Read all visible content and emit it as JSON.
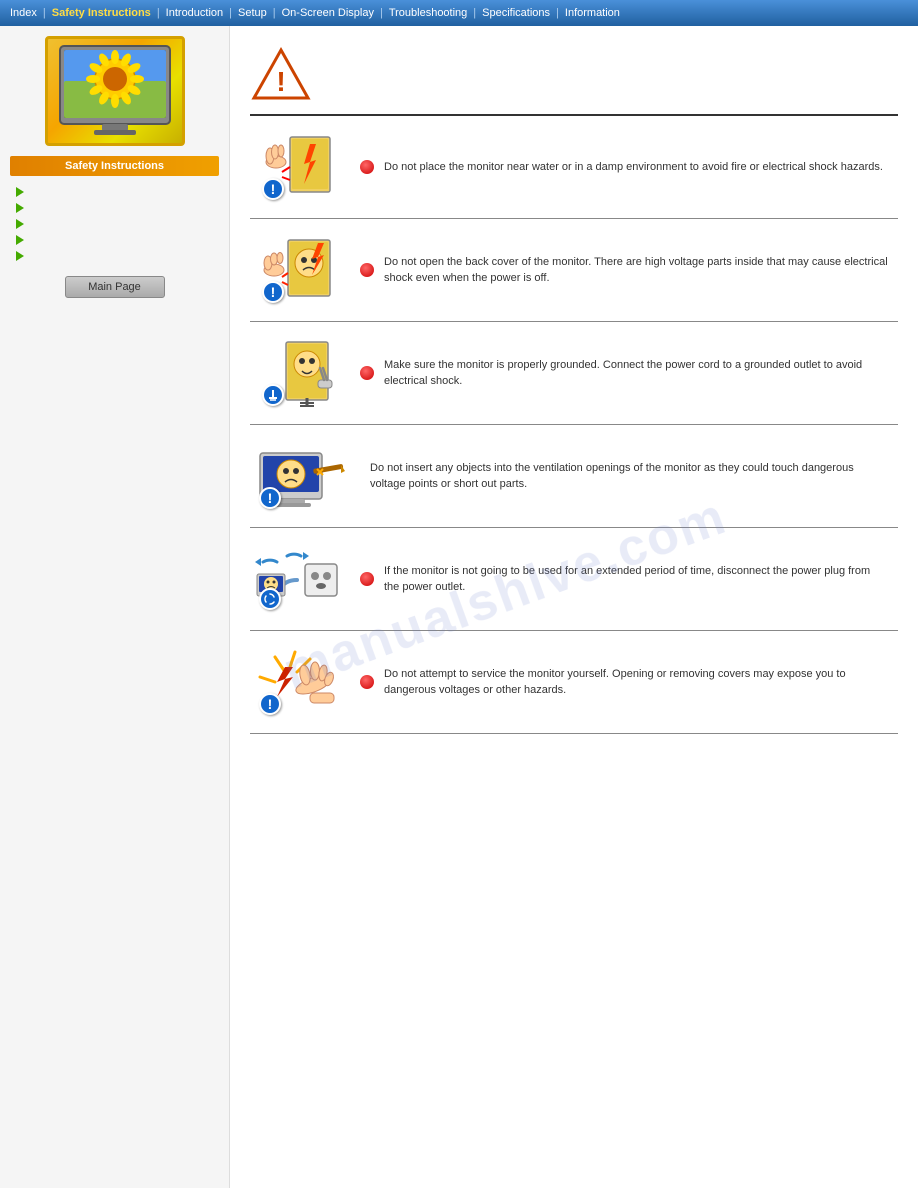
{
  "nav": {
    "items": [
      {
        "label": "Index",
        "active": false
      },
      {
        "label": "Safety Instructions",
        "active": true
      },
      {
        "label": "Introduction",
        "active": false
      },
      {
        "label": "Setup",
        "active": false
      },
      {
        "label": "On-Screen Display",
        "active": false
      },
      {
        "label": "Troubleshooting",
        "active": false
      },
      {
        "label": "Specifications",
        "active": false
      },
      {
        "label": "Information",
        "active": false
      }
    ]
  },
  "sidebar": {
    "title": "Safety Instructions",
    "arrow_items": [
      "",
      "",
      "",
      "",
      ""
    ],
    "main_page_label": "Main Page"
  },
  "content": {
    "rows": [
      {
        "id": "row1",
        "has_red_dot": true,
        "badge_type": "warning",
        "text": "Do not place the monitor near water or in a damp environment to avoid fire or electrical shock hazards."
      },
      {
        "id": "row2",
        "has_red_dot": true,
        "badge_type": "warning",
        "text": "Do not open the back cover of the monitor. There are high voltage parts inside that may cause electrical shock even when the power is off."
      },
      {
        "id": "row3",
        "has_red_dot": true,
        "badge_type": "ground",
        "text": "Make sure the monitor is properly grounded. Connect the power cord to a grounded outlet to avoid electrical shock."
      },
      {
        "id": "row4",
        "has_red_dot": false,
        "badge_type": "warning",
        "text": "Do not insert any objects into the ventilation openings of the monitor as they could touch dangerous voltage points or short out parts."
      },
      {
        "id": "row5",
        "has_red_dot": true,
        "badge_type": "recycle",
        "text": "If the monitor is not going to be used for an extended period of time, disconnect the power plug from the power outlet."
      },
      {
        "id": "row6",
        "has_red_dot": true,
        "badge_type": "warning",
        "text": "Do not attempt to service the monitor yourself. Opening or removing covers may expose you to dangerous voltages or other hazards."
      }
    ]
  },
  "watermark": "manualshlve.com"
}
